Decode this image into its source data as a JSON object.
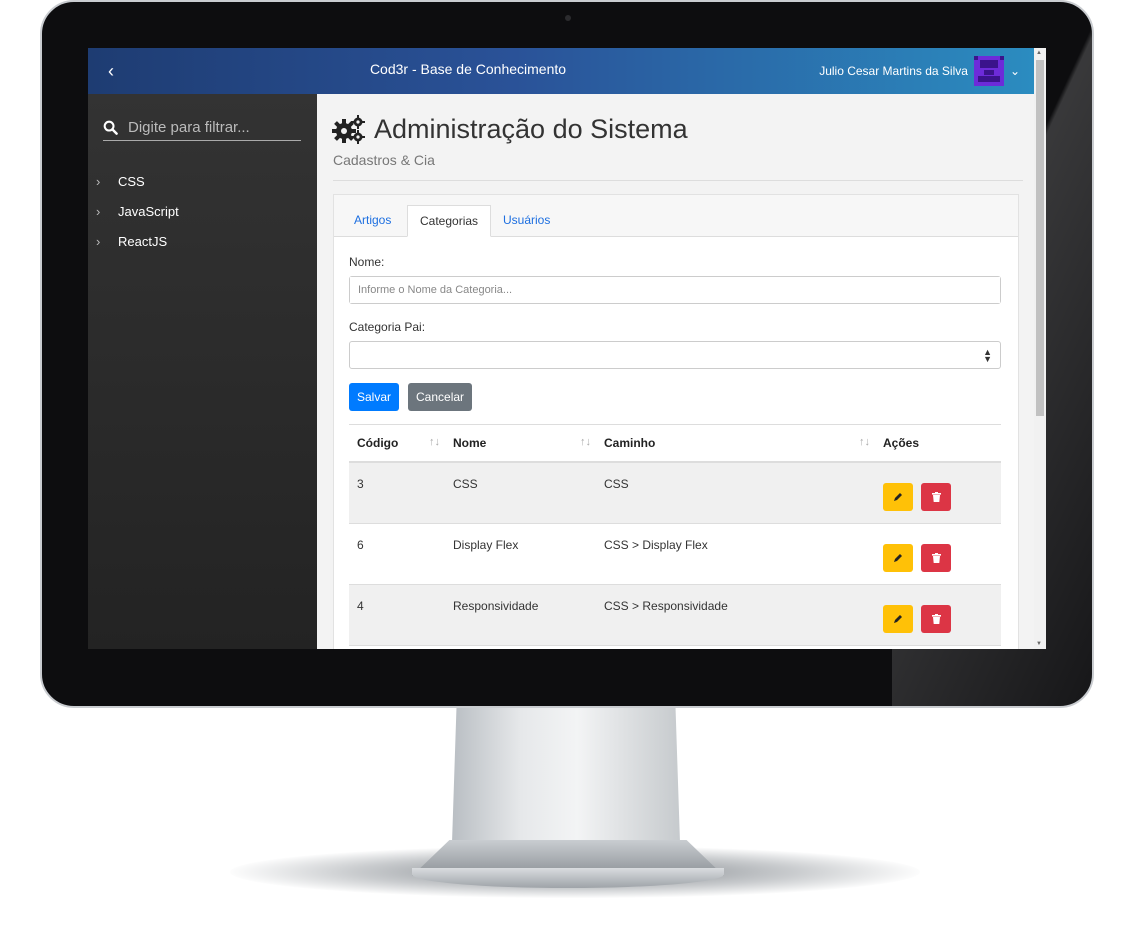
{
  "header": {
    "toggle_icon": "‹",
    "title": "Cod3r - Base de Conhecimento",
    "user_name": "Julio Cesar Martins da Silva",
    "user_caret": "⌄"
  },
  "sidebar": {
    "search_placeholder": "Digite para filtrar...",
    "items": [
      {
        "label": "CSS"
      },
      {
        "label": "JavaScript"
      },
      {
        "label": "ReactJS"
      }
    ]
  },
  "page": {
    "title": "Administração do Sistema",
    "subtitle": "Cadastros & Cia"
  },
  "tabs": [
    {
      "label": "Artigos",
      "active": false
    },
    {
      "label": "Categorias",
      "active": true
    },
    {
      "label": "Usuários",
      "active": false
    }
  ],
  "form": {
    "name_label": "Nome:",
    "name_placeholder": "Informe o Nome da Categoria...",
    "name_value": "",
    "parent_label": "Categoria Pai:",
    "parent_value": "",
    "save_label": "Salvar",
    "cancel_label": "Cancelar"
  },
  "table": {
    "columns": [
      "Código",
      "Nome",
      "Caminho",
      "Ações"
    ],
    "sort_glyph": "↑↓",
    "rows": [
      {
        "id": "3",
        "name": "CSS",
        "path": "CSS"
      },
      {
        "id": "6",
        "name": "Display Flex",
        "path": "CSS > Display Flex"
      },
      {
        "id": "4",
        "name": "Responsividade",
        "path": "CSS > Responsividade"
      }
    ]
  },
  "colors": {
    "header_start": "#1e3c72",
    "header_end": "#2b8cc0",
    "primary": "#007bff",
    "secondary": "#6c757d",
    "warning": "#ffc107",
    "danger": "#dc3545"
  },
  "icons": {
    "toggle": "chevron-left-icon",
    "search": "search-icon",
    "title": "gears-icon",
    "edit": "pencil-icon",
    "delete": "trash-icon"
  }
}
